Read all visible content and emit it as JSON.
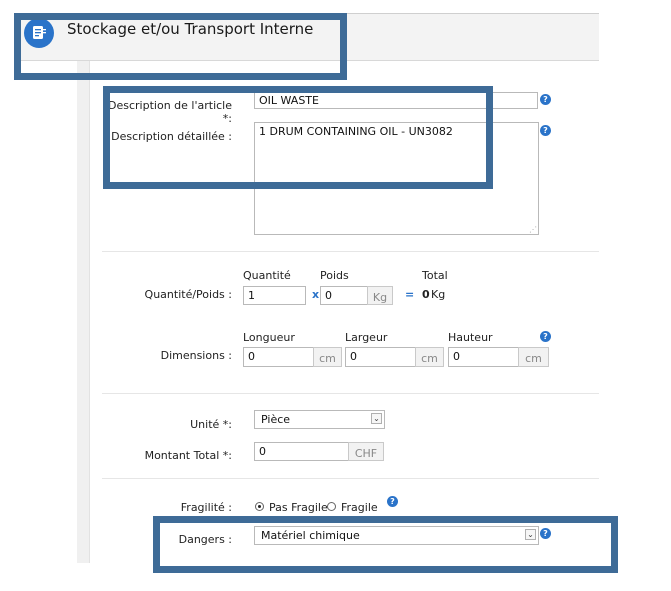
{
  "header": {
    "title": "Stockage et/ou Transport Interne",
    "app_icon": "clipboard-list-icon"
  },
  "article": {
    "description_label": "Description de l'article *:",
    "description_value": "OIL WASTE",
    "detail_label": "Description détaillée :",
    "detail_value": "1 DRUM CONTAINING OIL - UN3082"
  },
  "quantity": {
    "row_label": "Quantité/Poids :",
    "qty_caption": "Quantité",
    "weight_caption": "Poids",
    "total_caption": "Total",
    "qty_value": "1",
    "times_symbol": "x",
    "weight_value": "0",
    "weight_unit": "Kg",
    "equals_symbol": "=",
    "total_value": "0",
    "total_unit": "Kg"
  },
  "dimensions": {
    "row_label": "Dimensions :",
    "length_caption": "Longueur",
    "width_caption": "Largeur",
    "height_caption": "Hauteur",
    "length_value": "0",
    "width_value": "0",
    "height_value": "0",
    "unit": "cm"
  },
  "unit": {
    "label": "Unité *:",
    "selected": "Pièce"
  },
  "amount": {
    "label": "Montant Total *:",
    "value": "0",
    "currency": "CHF"
  },
  "fragility": {
    "label": "Fragilité :",
    "options": [
      {
        "label": "Pas Fragile",
        "checked": true
      },
      {
        "label": "Fragile",
        "checked": false
      }
    ]
  },
  "dangers": {
    "label": "Dangers :",
    "selected": "Matériel chimique"
  },
  "help_glyph": "?",
  "colors": {
    "accent": "#2a73c9",
    "overlay": "#3e6b97"
  }
}
